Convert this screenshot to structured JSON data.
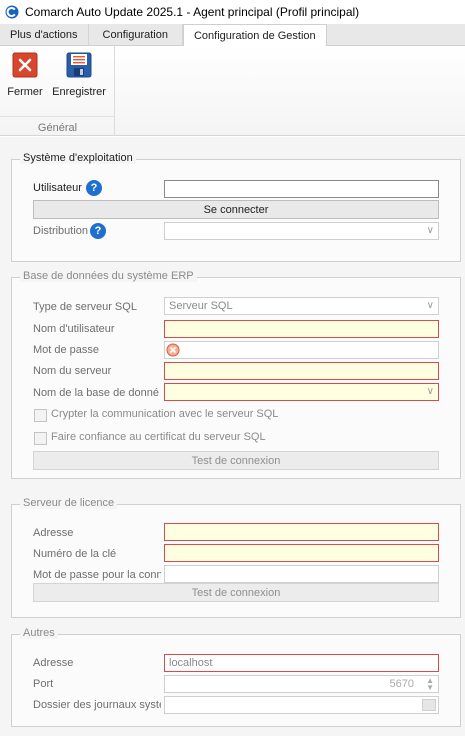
{
  "window": {
    "title": "Comarch Auto Update 2025.1 - Agent principal (Profil principal)"
  },
  "tabs": [
    {
      "label": "Plus d'actions"
    },
    {
      "label": "Configuration"
    },
    {
      "label": "Configuration de Gestion"
    }
  ],
  "ribbon": {
    "close_label": "Fermer",
    "save_label": "Enregistrer",
    "group_label": "Général"
  },
  "os_section": {
    "legend": "Système d'exploitation",
    "user_label": "Utilisateur",
    "user_value": "",
    "connect_label": "Se connecter",
    "distribution_label": "Distribution",
    "distribution_value": ""
  },
  "erp_section": {
    "legend": "Base de données du système ERP",
    "server_type_label": "Type de serveur SQL",
    "server_type_value": "Serveur SQL",
    "username_label": "Nom d'utilisateur",
    "password_label": "Mot de passe",
    "server_name_label": "Nom du serveur",
    "db_name_label": "Nom de la base de donné",
    "encrypt_label": "Crypter la communication avec le serveur SQL",
    "trust_label": "Faire confiance au certificat du serveur SQL",
    "test_label": "Test de connexion"
  },
  "license_section": {
    "legend": "Serveur de licence",
    "address_label": "Adresse",
    "key_label": "Numéro de la clé",
    "password_label": "Mot de passe pour la conne",
    "test_label": "Test de connexion"
  },
  "other_section": {
    "legend": "Autres",
    "address_label": "Adresse",
    "address_value": "localhost",
    "port_label": "Port",
    "port_value": "5670",
    "logs_label": "Dossier des journaux systè"
  },
  "colors": {
    "accent": "#1e6fd0",
    "required_bg": "#fefee0",
    "error_border": "#d94a4a"
  }
}
